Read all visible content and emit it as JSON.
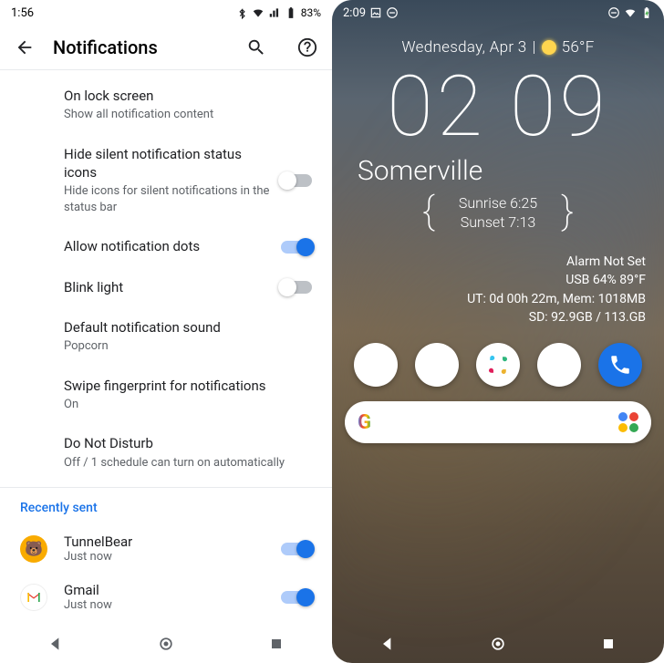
{
  "left": {
    "status": {
      "time": "1:56",
      "battery": "83%"
    },
    "header": {
      "title": "Notifications"
    },
    "settings": [
      {
        "title": "On lock screen",
        "sub": "Show all notification content",
        "toggle": null
      },
      {
        "title": "Hide silent notification status icons",
        "sub": "Hide icons for silent notifications in the status bar",
        "toggle": false
      },
      {
        "title": "Allow notification dots",
        "sub": "",
        "toggle": true
      },
      {
        "title": "Blink light",
        "sub": "",
        "toggle": false
      },
      {
        "title": "Default notification sound",
        "sub": "Popcorn",
        "toggle": null
      },
      {
        "title": "Swipe fingerprint for notifications",
        "sub": "On",
        "toggle": null
      },
      {
        "title": "Do Not Disturb",
        "sub": "Off / 1 schedule can turn on automatically",
        "toggle": null
      }
    ],
    "recently_label": "Recently sent",
    "recent": [
      {
        "app": "TunnelBear",
        "when": "Just now",
        "icon_bg": "#f9ab00",
        "toggle": true
      },
      {
        "app": "Gmail",
        "when": "Just now",
        "icon_bg": "#ffffff",
        "toggle": true
      }
    ]
  },
  "right": {
    "status": {
      "time": "2:09"
    },
    "date": "Wednesday, Apr 3",
    "temp": "56°F",
    "clock": "02 09",
    "city": "Somerville",
    "sunrise": "Sunrise 6:25",
    "sunset": "Sunset 7:13",
    "stats": {
      "alarm": "Alarm Not Set",
      "usb": "USB 64% 89°F",
      "ut": "UT: 0d 00h 22m, Mem: 1018MB",
      "sd": "SD: 92.9GB / 113.GB"
    },
    "dock": [
      "folder-1",
      "folder-2",
      "slack",
      "folder-3",
      "phone"
    ]
  }
}
